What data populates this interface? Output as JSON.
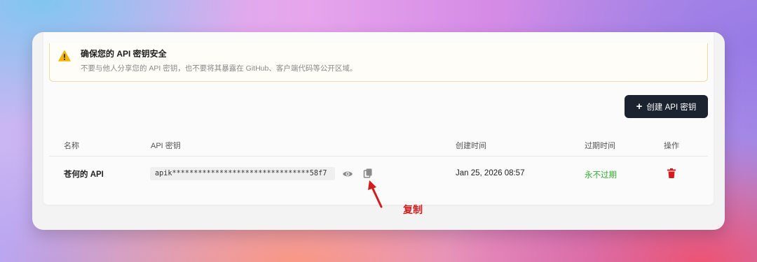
{
  "alert": {
    "title": "确保您的 API 密钥安全",
    "description": "不要与他人分享您的 API 密钥，也不要将其暴露在 GitHub、客户端代码等公开区域。",
    "icon": "warning-icon",
    "color": "#f5b400"
  },
  "toolbar": {
    "create_label": "创建 API 密钥",
    "create_icon": "plus-icon",
    "button_color": "#1b2330"
  },
  "table": {
    "headers": [
      "名称",
      "API 密钥",
      "创建时间",
      "过期时间",
      "操作"
    ],
    "rows": [
      {
        "name": "苍何的 API",
        "key": "apik********************************58f7",
        "created": "Jan 25, 2026 08:57",
        "expires": "永不过期",
        "actions": [
          "eye-icon",
          "copy-icon",
          "trash-icon"
        ]
      }
    ]
  },
  "annotation": {
    "text": "复制",
    "color": "#d41c1c"
  },
  "colors": {
    "expires_ok": "#2fb12f",
    "danger": "#d41c1c"
  }
}
